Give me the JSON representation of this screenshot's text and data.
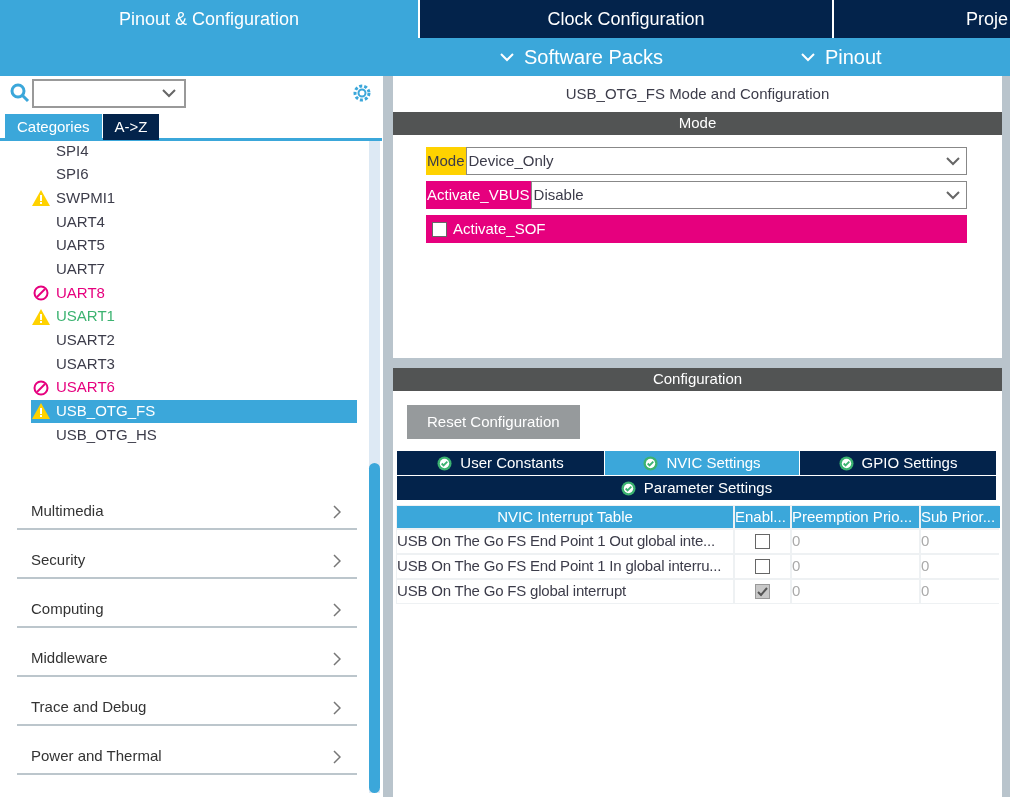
{
  "top_tabs": [
    {
      "label": "Pinout & Configuration",
      "selected": true
    },
    {
      "label": "Clock Configuration",
      "selected": false
    },
    {
      "label": "Proje",
      "selected": false
    }
  ],
  "sub_menu": [
    {
      "label": "Software Packs"
    },
    {
      "label": "Pinout"
    }
  ],
  "sidebar": {
    "view_tabs": [
      {
        "label": "Categories",
        "selected": true
      },
      {
        "label": "A->Z",
        "selected": false
      }
    ],
    "items": [
      {
        "label": "SPI4",
        "kind": "plain",
        "color": "#3c3c4a",
        "selected": false
      },
      {
        "label": "SPI6",
        "kind": "plain",
        "color": "#3c3c4a",
        "selected": false
      },
      {
        "label": "SWPMI1",
        "kind": "warning",
        "color": "#3c3c4a",
        "selected": false
      },
      {
        "label": "UART4",
        "kind": "plain",
        "color": "#3c3c4a",
        "selected": false
      },
      {
        "label": "UART5",
        "kind": "plain",
        "color": "#3c3c4a",
        "selected": false
      },
      {
        "label": "UART7",
        "kind": "plain",
        "color": "#3c3c4a",
        "selected": false
      },
      {
        "label": "UART8",
        "kind": "blocked",
        "color": "#e6007e",
        "selected": false
      },
      {
        "label": "USART1",
        "kind": "warning",
        "color": "#3cb371",
        "selected": false
      },
      {
        "label": "USART2",
        "kind": "plain",
        "color": "#3c3c4a",
        "selected": false
      },
      {
        "label": "USART3",
        "kind": "plain",
        "color": "#3c3c4a",
        "selected": false
      },
      {
        "label": "USART6",
        "kind": "blocked",
        "color": "#e6007e",
        "selected": false
      },
      {
        "label": "USB_OTG_FS",
        "kind": "warning",
        "selected": true
      },
      {
        "label": "USB_OTG_HS",
        "kind": "plain",
        "color": "#3c3c4a",
        "selected": false
      }
    ],
    "categories": [
      {
        "label": "Multimedia"
      },
      {
        "label": "Security"
      },
      {
        "label": "Computing"
      },
      {
        "label": "Middleware"
      },
      {
        "label": "Trace and Debug"
      },
      {
        "label": "Power and Thermal"
      }
    ]
  },
  "mode_panel": {
    "title": "USB_OTG_FS Mode and Configuration",
    "header": "Mode",
    "fields": [
      {
        "kind": "select",
        "label": "Mode",
        "value": "Device_Only",
        "color": "#ffd200"
      },
      {
        "kind": "select",
        "label": "Activate_VBUS",
        "value": "Disable",
        "color": "#e6007e"
      },
      {
        "kind": "checkbox",
        "label": "Activate_SOF",
        "checked": false,
        "color": "#e6007e"
      }
    ]
  },
  "config_panel": {
    "header": "Configuration",
    "reset_button": "Reset Configuration",
    "tabs": [
      {
        "label": "User Constants",
        "selected": false
      },
      {
        "label": "NVIC Settings",
        "selected": true
      },
      {
        "label": "GPIO Settings",
        "selected": false
      },
      {
        "label": "Parameter Settings",
        "selected": false
      }
    ],
    "table": {
      "columns": [
        "NVIC Interrupt Table",
        "Enabl...",
        "Preemption Prio...",
        "Sub Prior..."
      ],
      "rows": [
        {
          "name": "USB On The Go FS End Point 1 Out global inte...",
          "enabled": false,
          "disabled": false,
          "preemption": "0",
          "sub": "0"
        },
        {
          "name": "USB On The Go FS End Point 1 In global interru...",
          "enabled": false,
          "disabled": false,
          "preemption": "0",
          "sub": "0"
        },
        {
          "name": "USB On The Go FS global interrupt",
          "enabled": true,
          "disabled": true,
          "preemption": "0",
          "sub": "0"
        }
      ]
    }
  }
}
